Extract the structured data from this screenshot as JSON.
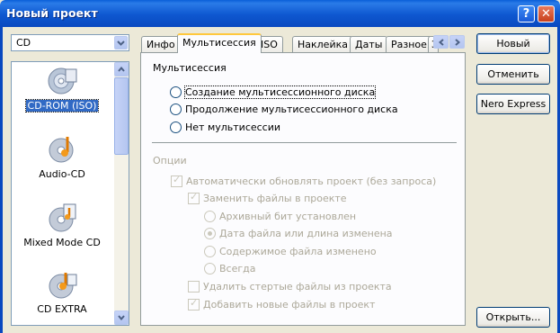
{
  "window": {
    "title": "Новый проект",
    "help_glyph": "?",
    "close_glyph": "✕"
  },
  "disc_type": {
    "value": "CD"
  },
  "project_list": [
    {
      "label": "CD-ROM (ISO)",
      "icon": "cd-rom-icon",
      "selected": true
    },
    {
      "label": "Audio-CD",
      "icon": "audio-cd-icon",
      "selected": false
    },
    {
      "label": "Mixed Mode CD",
      "icon": "mixed-mode-cd-icon",
      "selected": false
    },
    {
      "label": "CD EXTRA",
      "icon": "cd-extra-icon",
      "selected": false
    }
  ],
  "tabs": [
    {
      "label": "Инфо"
    },
    {
      "label": "Мультисессия",
      "active": true
    },
    {
      "label": "ISO"
    },
    {
      "label": "Наклейка"
    },
    {
      "label": "Даты"
    },
    {
      "label": "Разное"
    },
    {
      "label": "З"
    }
  ],
  "multisession": {
    "heading": "Мультисессия",
    "options": [
      {
        "label": "Создание мультисессионного диска"
      },
      {
        "label": "Продолжение мультисессионного диска"
      },
      {
        "label": "Нет мультисессии"
      }
    ]
  },
  "options_group": {
    "label": "Опции",
    "auto_update": {
      "label": "Автоматически обновлять проект (без запроса)",
      "checked": true
    },
    "replace_files": {
      "label": "Заменить файлы в проекте",
      "checked": true
    },
    "replace_criteria": [
      {
        "label": "Архивный бит установлен",
        "selected": false
      },
      {
        "label": "Дата файла или длина изменена",
        "selected": true
      },
      {
        "label": "Содержимое файла изменено",
        "selected": false
      },
      {
        "label": "Всегда",
        "selected": false
      }
    ],
    "delete_erased": {
      "label": "Удалить стертые файлы из проекта",
      "checked": false
    },
    "add_new": {
      "label": "Добавить новые файлы в проект",
      "checked": true
    }
  },
  "buttons": {
    "new": "Новый",
    "cancel": "Отменить",
    "nero_express": "Nero Express",
    "open": "Открыть..."
  },
  "colors": {
    "accent": "#316ac5",
    "titlebar": "#0a49c0",
    "disabled_text": "#aca899"
  }
}
